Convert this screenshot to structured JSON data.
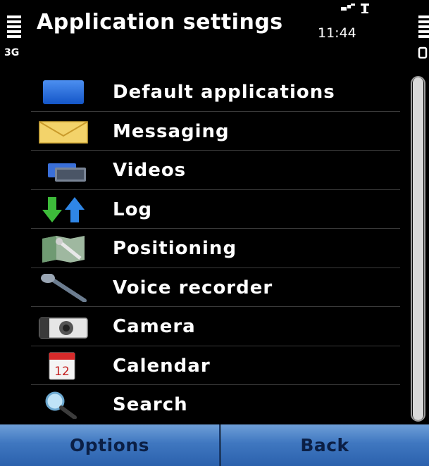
{
  "status": {
    "title": "Application settings",
    "time": "11:44",
    "network": "3G"
  },
  "menu": {
    "items": [
      {
        "label": "Default applications",
        "icon": "default-apps-icon"
      },
      {
        "label": "Messaging",
        "icon": "envelope-icon"
      },
      {
        "label": "Videos",
        "icon": "video-icon"
      },
      {
        "label": "Log",
        "icon": "log-arrows-icon"
      },
      {
        "label": "Positioning",
        "icon": "positioning-map-icon"
      },
      {
        "label": "Voice recorder",
        "icon": "microphone-icon"
      },
      {
        "label": "Camera",
        "icon": "camera-icon"
      },
      {
        "label": "Calendar",
        "icon": "calendar-icon",
        "day": "12"
      },
      {
        "label": "Search",
        "icon": "magnifier-icon"
      }
    ]
  },
  "softkeys": {
    "left": "Options",
    "right": "Back"
  },
  "colors": {
    "background": "#000000",
    "softkey_top": "#6e9fd8",
    "softkey_bottom": "#2b61ad",
    "softkey_text": "#0b1f45",
    "divider": "#3a3a3a",
    "scrollbar": "#d9d9d9"
  }
}
